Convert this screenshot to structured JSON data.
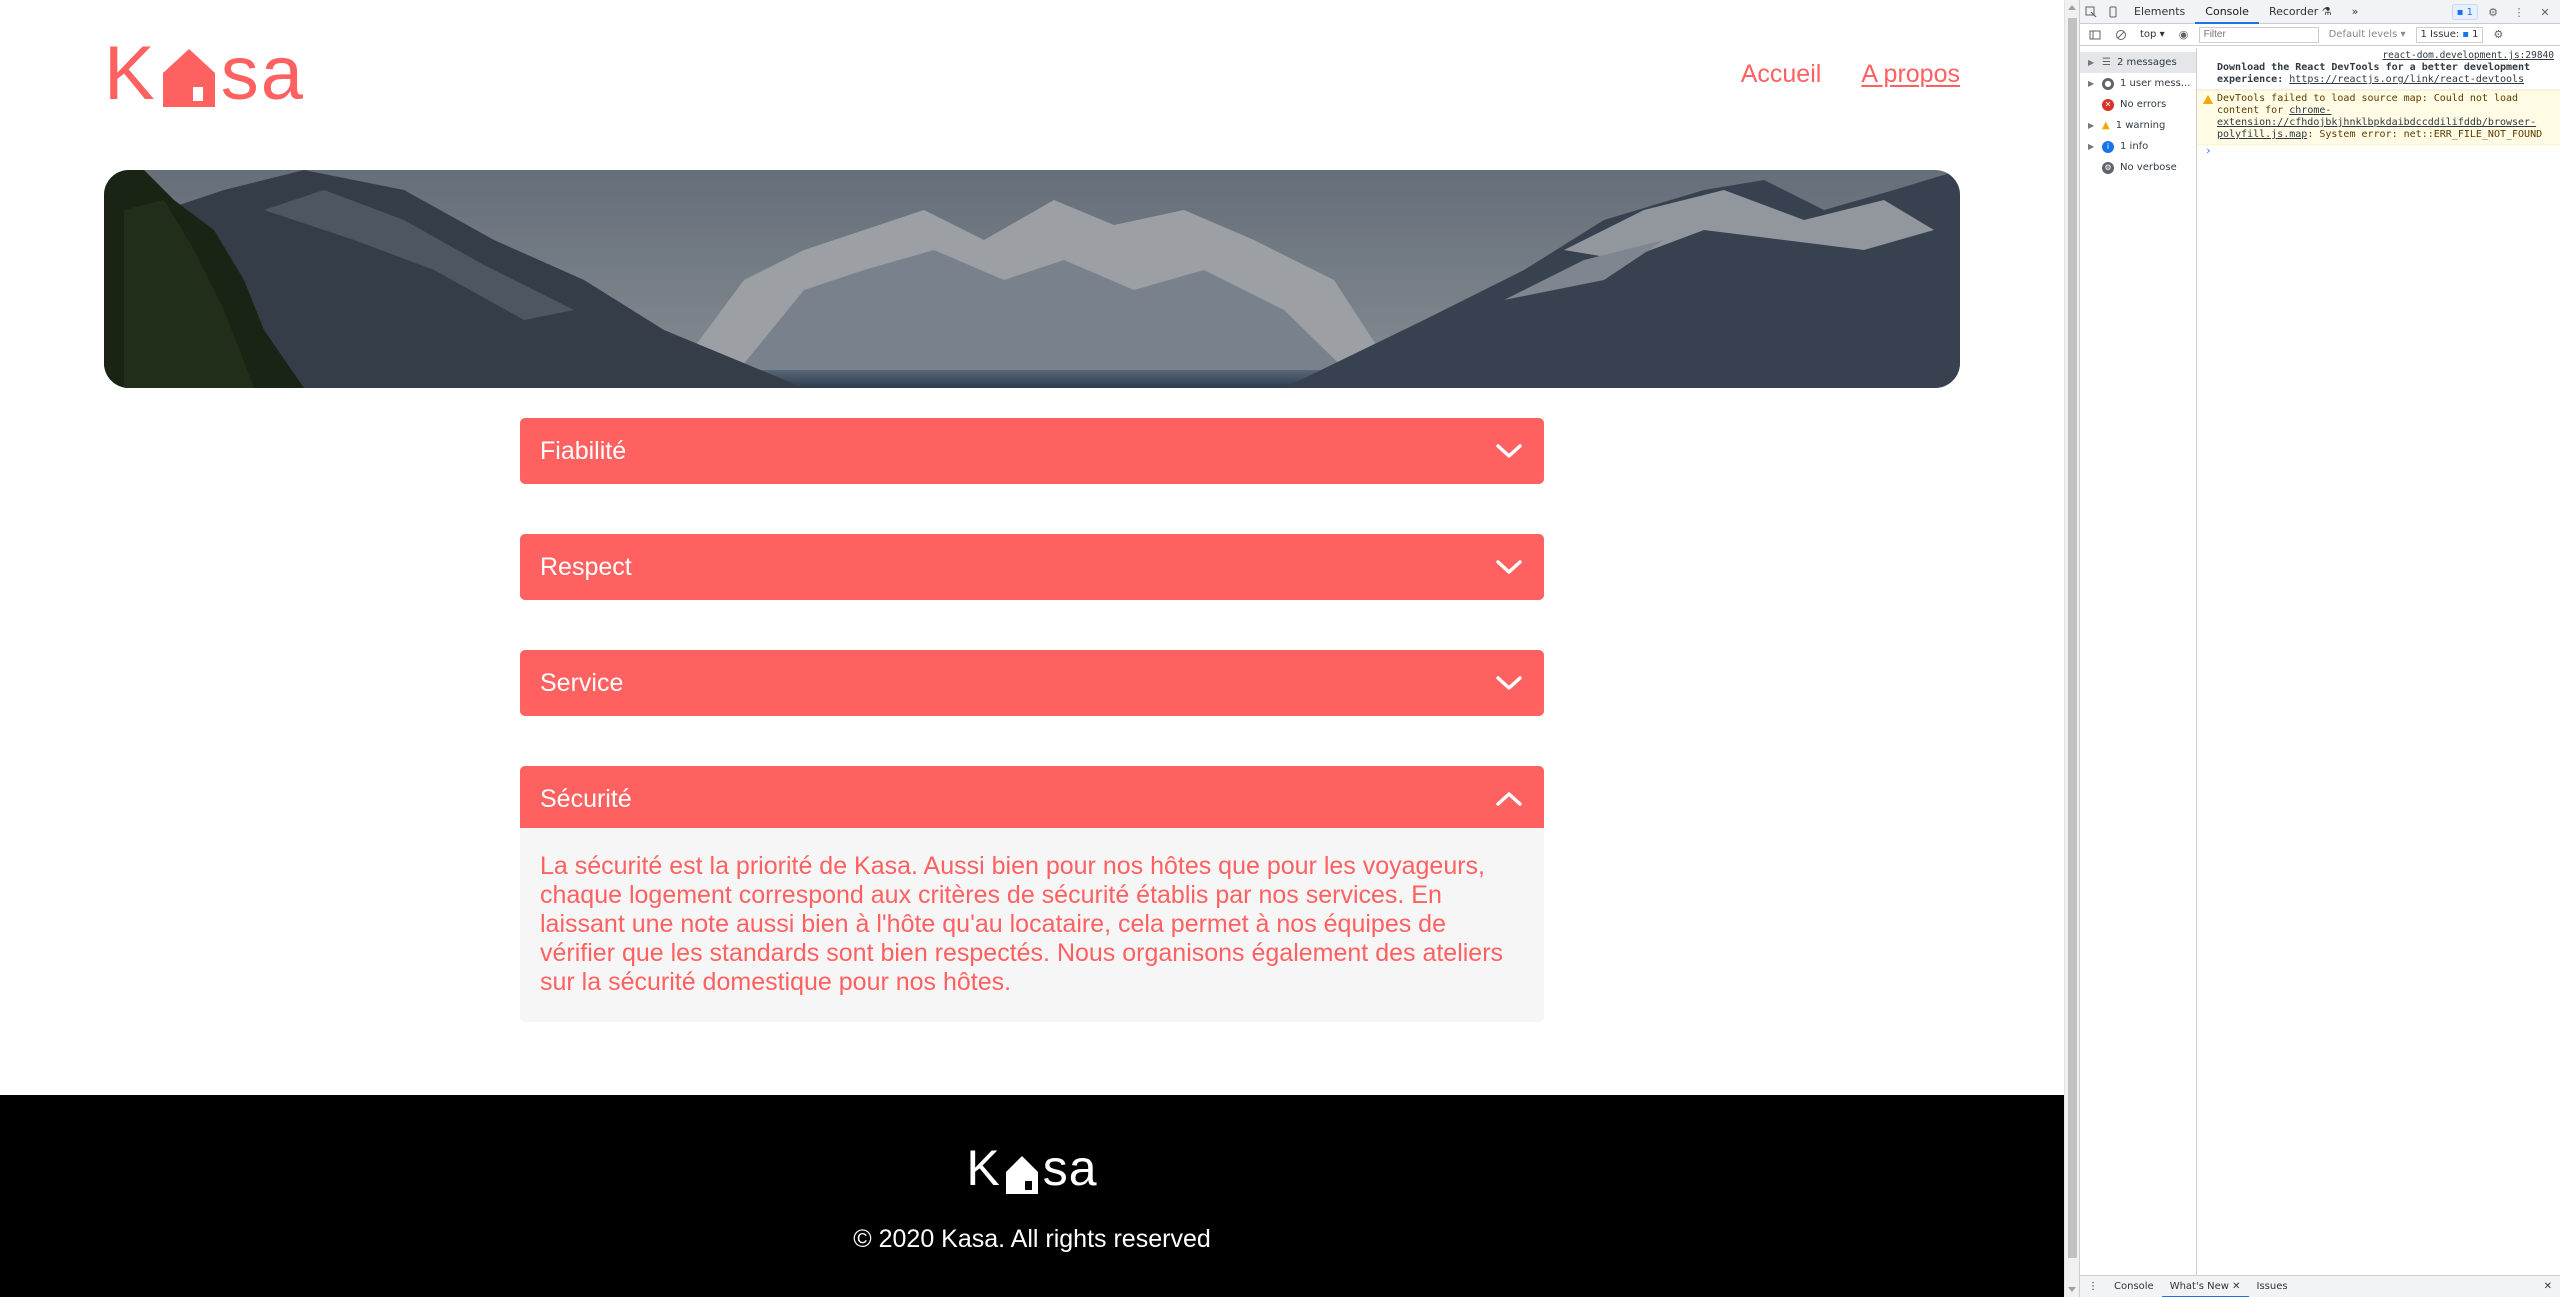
{
  "brand": {
    "logo_left": "K",
    "logo_right": "sa",
    "accent_color": "#FF6060"
  },
  "nav": {
    "items": [
      {
        "label": "Accueil",
        "active": false
      },
      {
        "label": "A propos",
        "active": true
      }
    ]
  },
  "banner": {
    "alt": "mountain-landscape-banner"
  },
  "accordions": [
    {
      "title": "Fiabilité",
      "open": false,
      "icon": "chevron-down-icon"
    },
    {
      "title": "Respect",
      "open": false,
      "icon": "chevron-down-icon"
    },
    {
      "title": "Service",
      "open": false,
      "icon": "chevron-down-icon"
    },
    {
      "title": "Sécurité",
      "open": true,
      "icon": "chevron-up-icon",
      "content": "La sécurité est la priorité de Kasa. Aussi bien pour nos hôtes que pour les voyageurs, chaque logement correspond aux critères de sécurité établis par nos services. En laissant une note aussi bien à l'hôte qu'au locataire, cela permet à nos équipes de vérifier que les standards sont bien respectés. Nous organisons également des ateliers sur la sécurité domestique pour nos hôtes."
    }
  ],
  "footer": {
    "logo_left": "K",
    "logo_right": "sa",
    "copyright": "© 2020 Kasa. All rights reserved"
  },
  "devtools": {
    "tabs": [
      "Elements",
      "Console",
      "Recorder"
    ],
    "active_tab": "Console",
    "recorder_icon": "flask-icon",
    "more": "»",
    "message_badge": "1",
    "context": "top ▾",
    "filter_placeholder": "Filter",
    "levels": "Default levels ▾",
    "issues_label": "1 Issue:",
    "issues_count": "1",
    "sidebar": [
      {
        "label": "2 messages",
        "icon": "list-icon",
        "selected": true
      },
      {
        "label": "1 user mess...",
        "icon": "user-icon",
        "selected": false
      },
      {
        "label": "No errors",
        "icon": "error-icon",
        "selected": false
      },
      {
        "label": "1 warning",
        "icon": "warning-icon",
        "selected": false
      },
      {
        "label": "1 info",
        "icon": "info-icon",
        "selected": false
      },
      {
        "label": "No verbose",
        "icon": "verbose-icon",
        "selected": false
      }
    ],
    "messages": {
      "info_source": "react-dom.development.js:29840",
      "info_text": "Download the React DevTools for a better development experience:",
      "info_link": "https://reactjs.org/link/react-devtools",
      "warn_text_1": "DevTools failed to load source map: Could not load content for",
      "warn_link": "chrome-extension://cfhdojbkjhnklbpkdaibdccddilifddb/browser-polyfill.js.map",
      "warn_text_2": ": System error: net::ERR_FILE_NOT_FOUND",
      "prompt": "›"
    },
    "bottom_tabs": [
      "Console",
      "What's New",
      "Issues"
    ],
    "bottom_active": "What's New"
  }
}
